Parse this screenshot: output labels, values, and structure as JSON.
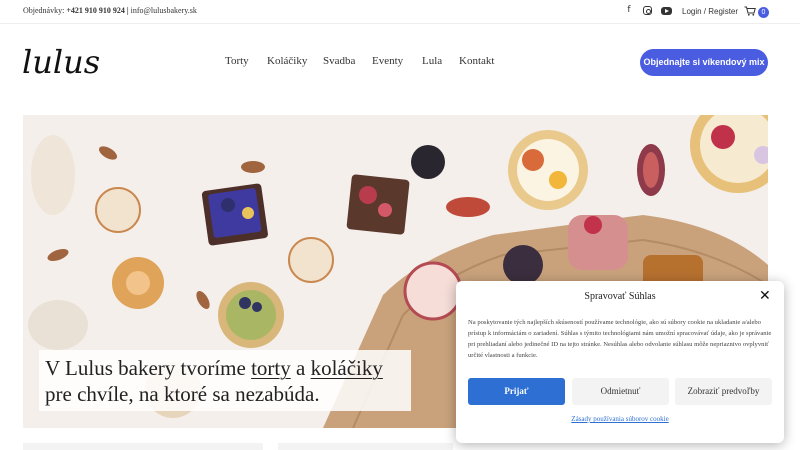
{
  "topbar": {
    "orders_label": "Objednávky:",
    "phone": "+421 910 910 924",
    "separator": "|",
    "email": "info@lulusbakery.sk",
    "social_icons": [
      "facebook-icon",
      "instagram-icon",
      "youtube-icon"
    ],
    "login_label": "Login / Register",
    "cart_icon": "cart-icon",
    "cart_count": "0"
  },
  "header": {
    "logo_text": "lulus",
    "nav": [
      "Torty",
      "Koláčiky",
      "Svadba",
      "Eventy",
      "Lula",
      "Kontakt"
    ],
    "cta_label": "Objednajte si víkendový mix"
  },
  "hero": {
    "line1_pre": "V Lulus bakery tvoríme ",
    "line1_link1": "torty",
    "line1_mid": " a ",
    "line1_link2": "koláčiky",
    "line2": "pre chvíle, na ktoré sa nezabúda."
  },
  "cookie_dialog": {
    "title": "Spravovať Súhlas",
    "text": "Na poskytovanie tých najlepších skúseností používame technológie, ako sú súbory cookie na ukladanie a/alebo prístup k informáciám o zariadení. Súhlas s týmito technológiami nám umožní spracovávať údaje, ako je správanie pri prehliadaní alebo jedinečné ID na tejto stránke. Nesúhlas alebo odvolanie súhlasu môže nepriaznivo ovplyvniť určité vlastnosti a funkcie.",
    "accept_label": "Prijať",
    "deny_label": "Odmietnuť",
    "prefs_label": "Zobraziť predvoľby",
    "policy_link": "Zásady používania súborov cookie"
  },
  "colors": {
    "accent": "#4a5de0",
    "accept_button": "#2d6fd2"
  }
}
